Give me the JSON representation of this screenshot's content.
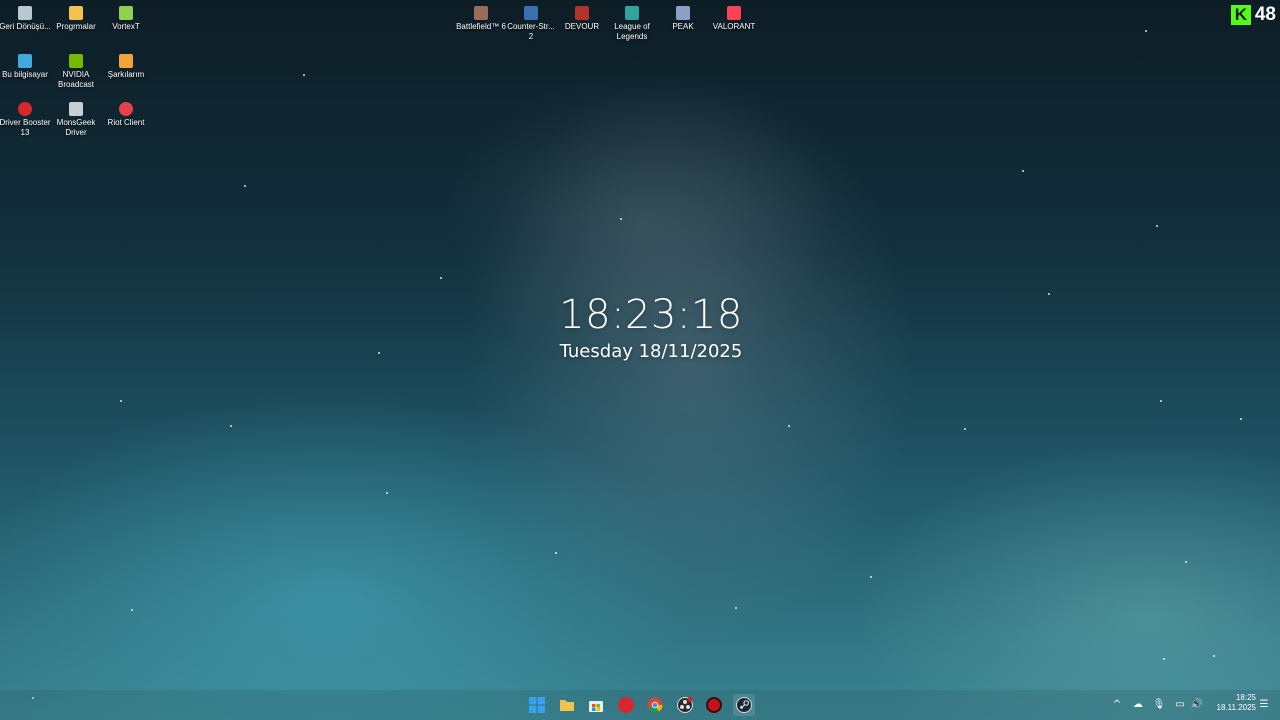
{
  "desktop_icons": {
    "recycle_bin": {
      "label": "Geri Dönüşü...",
      "color": "#b8c7d0"
    },
    "programs": {
      "label": "Progrmalar",
      "color": "#f2c14e"
    },
    "vortext": {
      "label": "VortexT",
      "color": "#8fd14f"
    },
    "this_pc": {
      "label": "Bu bilgisayar",
      "color": "#3fa9e0"
    },
    "nvidia_broadcast": {
      "label": "NVIDIA Broadcast",
      "color": "#76b900"
    },
    "songs": {
      "label": "Şarkılarım",
      "color": "#f2a33a"
    },
    "driver_booster": {
      "label": "Driver Booster 13",
      "color": "#d7262e"
    },
    "monsgeek": {
      "label": "MonsGeek Driver",
      "color": "#c9ced3"
    },
    "riot_client": {
      "label": "Riot Client",
      "color": "#e8404a"
    },
    "battlefield": {
      "label": "Battlefield™ 6",
      "color": "#9a6b5a"
    },
    "counter_strike": {
      "label": "Counter-Str... 2",
      "color": "#3b6fb0"
    },
    "devour": {
      "label": "DEVOUR",
      "color": "#b3322a"
    },
    "league": {
      "label": "League of Legends",
      "color": "#2fa59b"
    },
    "peak": {
      "label": "PEAK",
      "color": "#8aa0c8"
    },
    "valorant": {
      "label": "VALORANT",
      "color": "#fa4454"
    }
  },
  "clock": {
    "time": "18:23:18",
    "date": "Tuesday 18/11/2025"
  },
  "badge": {
    "letter": "K",
    "count": "48"
  },
  "taskbar": {
    "apps": [
      {
        "name": "start",
        "color": "#3aa0f0"
      },
      {
        "name": "file-explorer",
        "color": "#f2c14e"
      },
      {
        "name": "microsoft-store",
        "color": "#e9eef2"
      },
      {
        "name": "riot-app",
        "color": "#d7262e"
      },
      {
        "name": "chrome",
        "color": "#4caf50"
      },
      {
        "name": "obs",
        "color": "#3b3b3b"
      },
      {
        "name": "red-app",
        "color": "#c1121f"
      },
      {
        "name": "steam",
        "color": "#1b2838"
      }
    ],
    "tray": {
      "chevron": "^",
      "cloud": "☁",
      "mic": "🎙",
      "network": "▭",
      "volume": "🔊",
      "notifications": "☰"
    },
    "time": "18:25",
    "date": "18.11.2025"
  }
}
